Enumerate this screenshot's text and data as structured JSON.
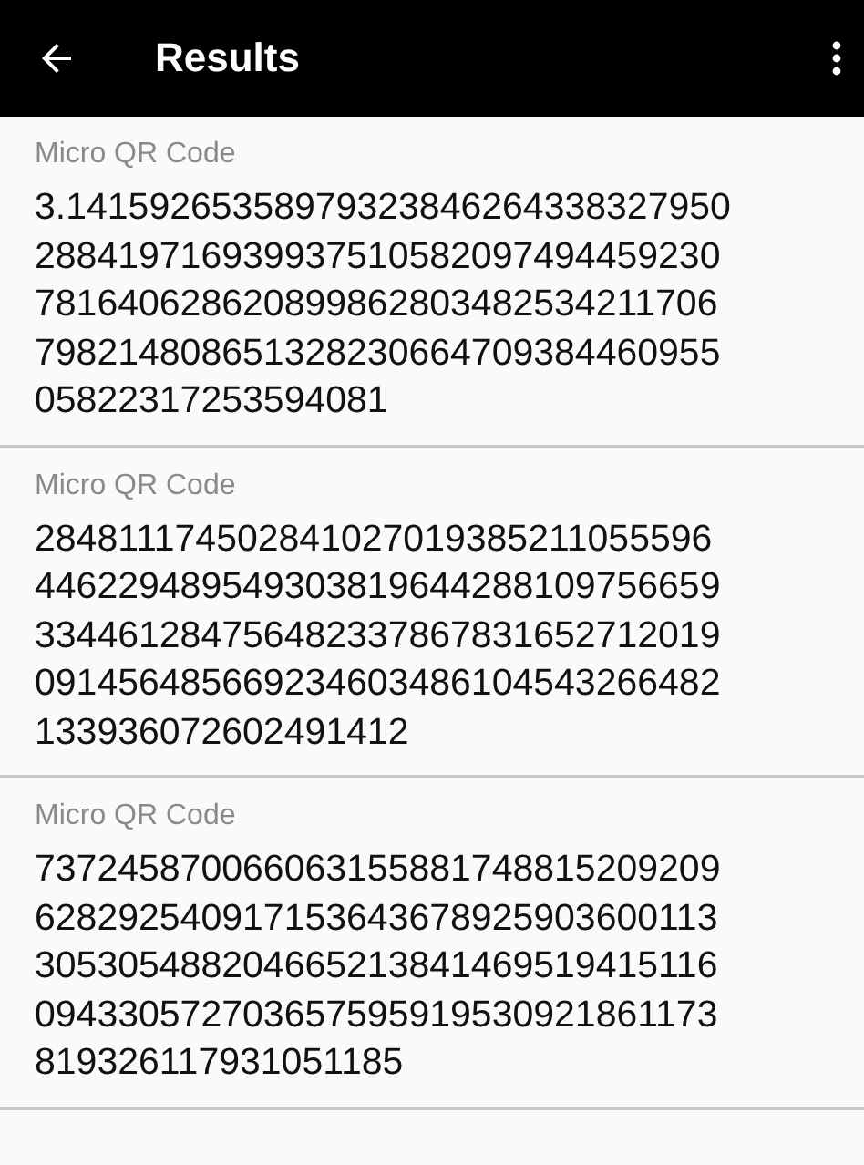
{
  "app_bar": {
    "title": "Results"
  },
  "results": [
    {
      "format": "Micro QR Code",
      "content": "3.14159265358979323846264338327950\n288419716939937510582097494459230\n781640628620899862803482534211706\n798214808651328230664709384460955\n05822317253594081"
    },
    {
      "format": "Micro QR Code",
      "content": "284811174502841027019385211055596\n446229489549303819644288109756659\n334461284756482337867831652712019\n091456485669234603486104543266482\n133936072602491412"
    },
    {
      "format": "Micro QR Code",
      "content": "737245870066063155881748815209209\n628292540917153643678925903600113\n305305488204665213841469519415116\n094330572703657595919530921861173\n819326117931051185"
    }
  ]
}
